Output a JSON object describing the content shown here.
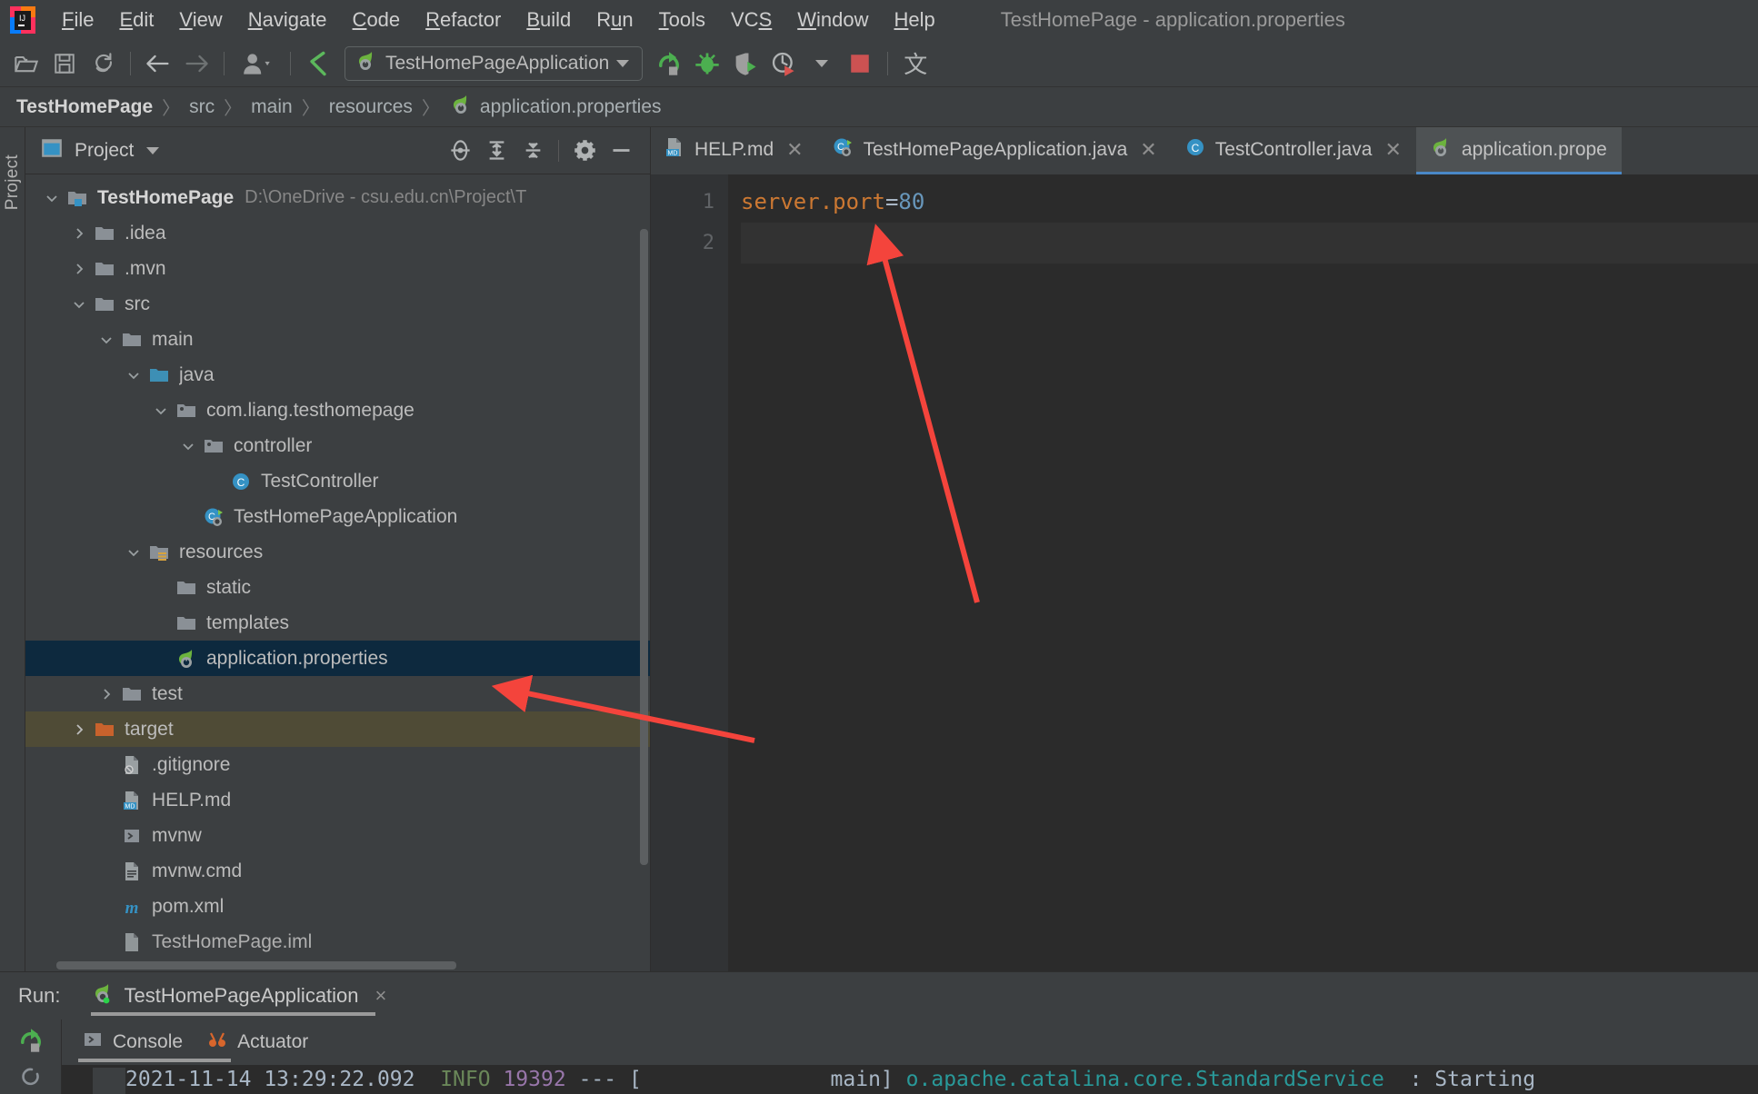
{
  "window": {
    "title": "TestHomePage - application.properties",
    "app_icon": "intellij-idea-logo"
  },
  "menubar": {
    "items": [
      {
        "label": "File",
        "mnemonic": "F"
      },
      {
        "label": "Edit",
        "mnemonic": "E"
      },
      {
        "label": "View",
        "mnemonic": "V"
      },
      {
        "label": "Navigate",
        "mnemonic": "N"
      },
      {
        "label": "Code",
        "mnemonic": "C"
      },
      {
        "label": "Refactor",
        "mnemonic": "R"
      },
      {
        "label": "Build",
        "mnemonic": "B"
      },
      {
        "label": "Run",
        "mnemonic": "u"
      },
      {
        "label": "Tools",
        "mnemonic": "T"
      },
      {
        "label": "VCS",
        "mnemonic": "S"
      },
      {
        "label": "Window",
        "mnemonic": "W"
      },
      {
        "label": "Help",
        "mnemonic": "H"
      }
    ]
  },
  "toolbar": {
    "buttons": [
      {
        "name": "open-folder-icon",
        "tooltip": "Open"
      },
      {
        "name": "save-all-icon",
        "tooltip": "Save All"
      },
      {
        "name": "sync-refresh-icon",
        "tooltip": "Synchronize"
      },
      {
        "name": "back-arrow-icon",
        "tooltip": "Back"
      },
      {
        "name": "forward-arrow-icon",
        "tooltip": "Forward"
      },
      {
        "name": "user-profile-icon",
        "tooltip": "Profile"
      },
      {
        "name": "build-hammer-icon",
        "tooltip": "Build Project"
      }
    ],
    "run_config": {
      "label": "TestHomePageApplication",
      "icon": "spring-boot-icon"
    },
    "run_buttons": [
      {
        "name": "run-icon",
        "tooltip": "Run",
        "color": "#4caf50"
      },
      {
        "name": "debug-icon",
        "tooltip": "Debug",
        "color": "#4caf50"
      },
      {
        "name": "run-with-coverage-icon",
        "tooltip": "Run with Coverage"
      },
      {
        "name": "profiler-icon",
        "tooltip": "Profile"
      },
      {
        "name": "stop-icon",
        "tooltip": "Stop",
        "color": "#cc5252"
      },
      {
        "name": "translate-icon",
        "tooltip": "Translate",
        "glyph": "文"
      }
    ]
  },
  "breadcrumb": {
    "separator": "〉",
    "items": [
      {
        "label": "TestHomePage",
        "bold": true,
        "icon": ""
      },
      {
        "label": "src",
        "bold": false,
        "icon": ""
      },
      {
        "label": "main",
        "bold": false,
        "icon": ""
      },
      {
        "label": "resources",
        "bold": false,
        "icon": ""
      },
      {
        "label": "application.properties",
        "bold": false,
        "icon": "spring-properties-icon"
      }
    ]
  },
  "left_tool_window_bar": {
    "items": [
      {
        "label": "Project",
        "name": "tool-window-stripe-project"
      }
    ]
  },
  "project_panel": {
    "title": "Project",
    "view_icon": "project-view-icon",
    "toolbar_icons": [
      {
        "name": "locate-target-icon",
        "tooltip": "Select Opened File"
      },
      {
        "name": "expand-all-icon",
        "tooltip": "Expand All"
      },
      {
        "name": "collapse-all-icon",
        "tooltip": "Collapse All"
      },
      {
        "name": "gear-settings-icon",
        "tooltip": "Settings"
      },
      {
        "name": "hide-minimize-icon",
        "tooltip": "Hide"
      }
    ],
    "tree": [
      {
        "label": "TestHomePage",
        "path": "D:\\OneDrive - csu.edu.cn\\Project\\T",
        "depth": 0,
        "chevron": "down",
        "icon": "module-root-icon",
        "bold": true,
        "state": "normal"
      },
      {
        "label": ".idea",
        "path": "",
        "depth": 1,
        "chevron": "right",
        "icon": "folder-icon",
        "bold": false,
        "state": "normal"
      },
      {
        "label": ".mvn",
        "path": "",
        "depth": 1,
        "chevron": "right",
        "icon": "folder-icon",
        "bold": false,
        "state": "normal"
      },
      {
        "label": "src",
        "path": "",
        "depth": 1,
        "chevron": "down",
        "icon": "folder-icon",
        "bold": false,
        "state": "normal"
      },
      {
        "label": "main",
        "path": "",
        "depth": 2,
        "chevron": "down",
        "icon": "folder-icon",
        "bold": false,
        "state": "normal"
      },
      {
        "label": "java",
        "path": "",
        "depth": 3,
        "chevron": "down",
        "icon": "source-root-icon",
        "bold": false,
        "state": "normal"
      },
      {
        "label": "com.liang.testhomepage",
        "path": "",
        "depth": 4,
        "chevron": "down",
        "icon": "package-icon",
        "bold": false,
        "state": "normal"
      },
      {
        "label": "controller",
        "path": "",
        "depth": 5,
        "chevron": "down",
        "icon": "package-icon",
        "bold": false,
        "state": "normal"
      },
      {
        "label": "TestController",
        "path": "",
        "depth": 6,
        "chevron": "none",
        "icon": "java-class-icon",
        "bold": false,
        "state": "normal"
      },
      {
        "label": "TestHomePageApplication",
        "path": "",
        "depth": 5,
        "chevron": "none",
        "icon": "spring-boot-class-icon",
        "bold": false,
        "state": "normal"
      },
      {
        "label": "resources",
        "path": "",
        "depth": 3,
        "chevron": "down",
        "icon": "resource-root-icon",
        "bold": false,
        "state": "normal"
      },
      {
        "label": "static",
        "path": "",
        "depth": 4,
        "chevron": "none",
        "icon": "folder-icon",
        "bold": false,
        "state": "normal"
      },
      {
        "label": "templates",
        "path": "",
        "depth": 4,
        "chevron": "none",
        "icon": "folder-icon",
        "bold": false,
        "state": "normal"
      },
      {
        "label": "application.properties",
        "path": "",
        "depth": 4,
        "chevron": "none",
        "icon": "spring-properties-icon",
        "bold": false,
        "state": "selected"
      },
      {
        "label": "test",
        "path": "",
        "depth": 2,
        "chevron": "right",
        "icon": "folder-icon",
        "bold": false,
        "state": "normal"
      },
      {
        "label": "target",
        "path": "",
        "depth": 1,
        "chevron": "right",
        "icon": "excluded-folder-icon",
        "bold": false,
        "state": "highlighted"
      },
      {
        "label": ".gitignore",
        "path": "",
        "depth": 2,
        "chevron": "none",
        "icon": "gitignore-file-icon",
        "bold": false,
        "state": "normal"
      },
      {
        "label": "HELP.md",
        "path": "",
        "depth": 2,
        "chevron": "none",
        "icon": "markdown-file-icon",
        "bold": false,
        "state": "normal"
      },
      {
        "label": "mvnw",
        "path": "",
        "depth": 2,
        "chevron": "none",
        "icon": "shell-script-icon",
        "bold": false,
        "state": "normal"
      },
      {
        "label": "mvnw.cmd",
        "path": "",
        "depth": 2,
        "chevron": "none",
        "icon": "cmd-script-icon",
        "bold": false,
        "state": "normal"
      },
      {
        "label": "pom.xml",
        "path": "",
        "depth": 2,
        "chevron": "none",
        "icon": "maven-pom-icon",
        "bold": false,
        "state": "normal"
      },
      {
        "label": "TestHomePage.iml",
        "path": "",
        "depth": 2,
        "chevron": "none",
        "icon": "iml-file-icon",
        "bold": false,
        "state": "normal"
      }
    ]
  },
  "editor": {
    "tabs": [
      {
        "label": "HELP.md",
        "icon": "markdown-file-icon",
        "active": false,
        "closable": true
      },
      {
        "label": "TestHomePageApplication.java",
        "icon": "spring-boot-class-icon",
        "active": false,
        "closable": true
      },
      {
        "label": "TestController.java",
        "icon": "java-class-icon",
        "active": false,
        "closable": true
      },
      {
        "label": "application.prope",
        "icon": "spring-properties-icon",
        "active": true,
        "closable": false
      }
    ],
    "line_numbers": [
      "1",
      "2"
    ],
    "lines": [
      {
        "key": "server.port",
        "eq": "=",
        "value": "80"
      },
      {
        "key": "",
        "eq": "",
        "value": ""
      }
    ]
  },
  "run_panel": {
    "label": "Run:",
    "tab": {
      "label": "TestHomePageApplication",
      "icon": "spring-boot-run-icon",
      "close": "×"
    },
    "side_tools": [
      {
        "name": "rerun-icon",
        "tooltip": "Rerun"
      },
      {
        "name": "stop-process-icon",
        "tooltip": "Stop"
      }
    ],
    "subtabs": [
      {
        "label": "Console",
        "icon": "console-icon",
        "active": true
      },
      {
        "label": "Actuator",
        "icon": "actuator-icon",
        "active": false
      }
    ],
    "console_line": {
      "timestamp": "2021-11-14 13:29:22.092",
      "level": "INFO",
      "pid": "19392",
      "dashes": "---",
      "bracket_open": "[",
      "thread": "main]",
      "logger": "o.apache.catalina.core.StandardService",
      "colon": ":",
      "message": "Starting"
    }
  },
  "annotations": {
    "arrows": [
      {
        "name": "arrow-to-editor-line",
        "color": "#f4443c"
      },
      {
        "name": "arrow-to-application-properties-file",
        "color": "#f4443c"
      }
    ]
  },
  "colors": {
    "accent_blue": "#4a88c7",
    "selection": "#0d293e",
    "target_highlight": "#4f4b36",
    "editor_bg": "#2b2b2b",
    "panel_bg": "#3c3f41",
    "annotation_red": "#f4443c"
  }
}
